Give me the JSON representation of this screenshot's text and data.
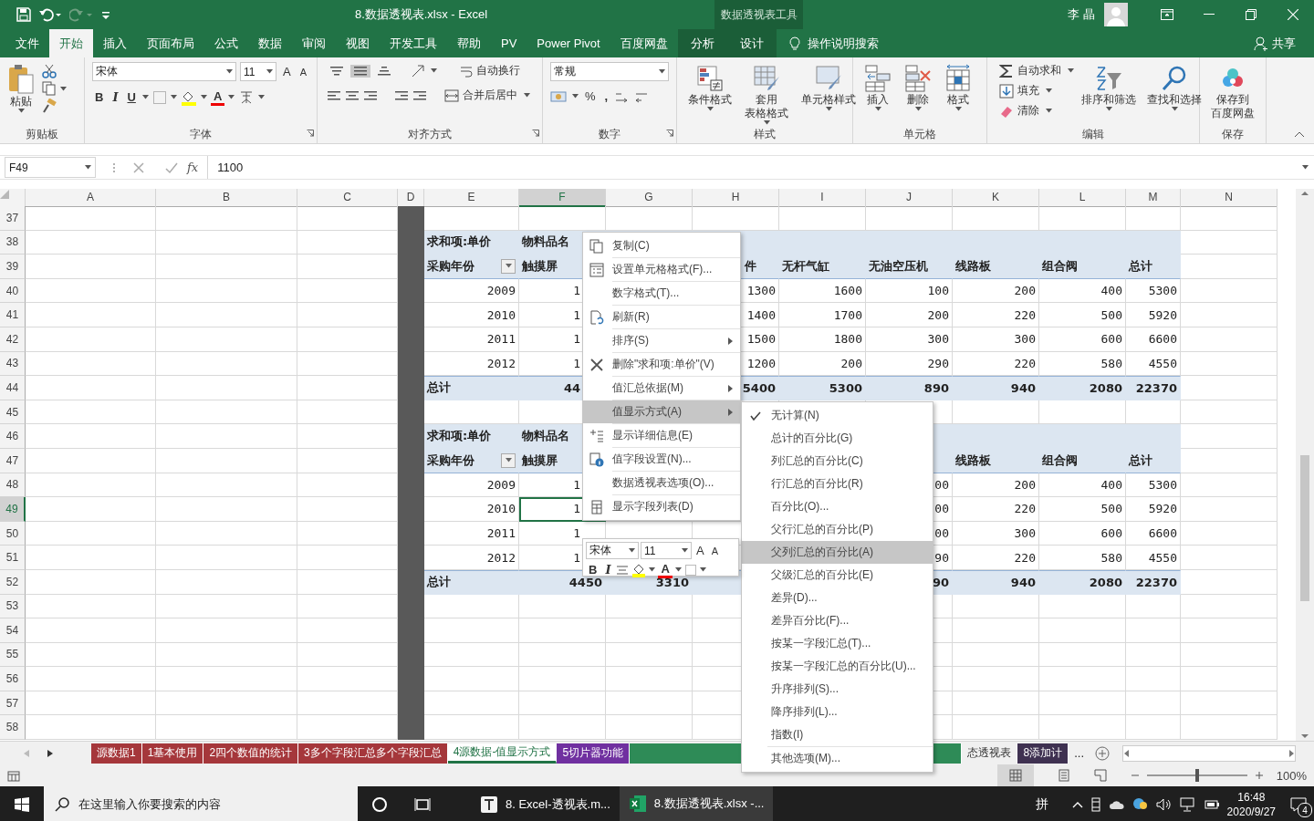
{
  "title_bar": {
    "title": "8.数据透视表.xlsx  -  Excel",
    "context_title": "数据透视表工具",
    "user": "李 晶"
  },
  "ribbon_tabs": [
    {
      "label": "文件",
      "selected": false,
      "contextual": false
    },
    {
      "label": "开始",
      "selected": true,
      "contextual": false
    },
    {
      "label": "插入",
      "selected": false,
      "contextual": false
    },
    {
      "label": "页面布局",
      "selected": false,
      "contextual": false
    },
    {
      "label": "公式",
      "selected": false,
      "contextual": false
    },
    {
      "label": "数据",
      "selected": false,
      "contextual": false
    },
    {
      "label": "审阅",
      "selected": false,
      "contextual": false
    },
    {
      "label": "视图",
      "selected": false,
      "contextual": false
    },
    {
      "label": "开发工具",
      "selected": false,
      "contextual": false
    },
    {
      "label": "帮助",
      "selected": false,
      "contextual": false
    },
    {
      "label": "PV",
      "selected": false,
      "contextual": false
    },
    {
      "label": "Power Pivot",
      "selected": false,
      "contextual": false
    },
    {
      "label": "百度网盘",
      "selected": false,
      "contextual": false
    },
    {
      "label": "分析",
      "selected": false,
      "contextual": true
    },
    {
      "label": "设计",
      "selected": false,
      "contextual": true
    }
  ],
  "tell_me": "操作说明搜索",
  "share": "共享",
  "ribbon_groups": [
    {
      "kind": "clipboard",
      "label": "剪贴板",
      "paste": "粘贴"
    },
    {
      "kind": "font",
      "label": "字体",
      "font": "宋体",
      "size": "11",
      "grow": "A",
      "shrink": "A",
      "bold": "B",
      "italic": "I",
      "underline": "U",
      "color_letter": "A"
    },
    {
      "kind": "alignment",
      "label": "对齐方式",
      "wrap": "自动换行",
      "merge": "合并后居中",
      "middle_selected": true
    },
    {
      "kind": "number",
      "label": "数字",
      "format": "常规",
      "percent": "%",
      "comma": ","
    },
    {
      "kind": "large",
      "label": "样式",
      "buttons": [
        [
          "条件格式"
        ],
        [
          "套用",
          "表格格式"
        ],
        [
          "单元格样式"
        ]
      ]
    },
    {
      "kind": "large",
      "label": "单元格",
      "buttons": [
        [
          "插入"
        ],
        [
          "删除"
        ],
        [
          "格式"
        ]
      ]
    },
    {
      "kind": "editing",
      "label": "编辑",
      "small": [
        "自动求和",
        "填充",
        "清除"
      ],
      "large": [
        "排序和筛选",
        "查找和选择"
      ]
    },
    {
      "kind": "large",
      "label": "保存",
      "buttons": [
        [
          "保存到",
          "百度网盘"
        ]
      ]
    }
  ],
  "formula_bar": {
    "name_box": "F49",
    "fx_label": "fx",
    "value": "1100"
  },
  "columns": [
    {
      "label": "A",
      "selected": false,
      "shaded": false
    },
    {
      "label": "B",
      "selected": false,
      "shaded": false
    },
    {
      "label": "C",
      "selected": false,
      "shaded": false
    },
    {
      "label": "D",
      "selected": false,
      "shaded": true
    },
    {
      "label": "E",
      "selected": false,
      "shaded": false
    },
    {
      "label": "F",
      "selected": true,
      "shaded": false
    },
    {
      "label": "G",
      "selected": false,
      "shaded": false
    },
    {
      "label": "H",
      "selected": false,
      "shaded": false
    },
    {
      "label": "I",
      "selected": false,
      "shaded": false
    },
    {
      "label": "J",
      "selected": false,
      "shaded": false
    },
    {
      "label": "K",
      "selected": false,
      "shaded": false
    },
    {
      "label": "L",
      "selected": false,
      "shaded": false
    },
    {
      "label": "M",
      "selected": false,
      "shaded": false
    },
    {
      "label": "N",
      "selected": false,
      "shaded": false
    }
  ],
  "rows": [
    {
      "number": "37",
      "selected": false,
      "kind": "plain",
      "cells": {}
    },
    {
      "number": "38",
      "selected": false,
      "kind": "title",
      "cells": {
        "E": {
          "text": "求和项:单价"
        },
        "F": {
          "text": "物料品名"
        }
      }
    },
    {
      "number": "39",
      "selected": false,
      "kind": "header",
      "cells": {
        "E": {
          "text": "采购年份",
          "filter": true
        },
        "F": {
          "text": "触摸屏"
        },
        "H": {
          "text": "件",
          "kind": "fragment"
        },
        "I": {
          "text": "无杆气缸"
        },
        "J": {
          "text": "无油空压机"
        },
        "K": {
          "text": "线路板"
        },
        "L": {
          "text": "组合阀"
        },
        "M": {
          "text": "总计"
        }
      }
    },
    {
      "number": "40",
      "selected": false,
      "kind": "data",
      "cells": {
        "E": {
          "text": "2009"
        },
        "F": {
          "text": "1",
          "kind": "fragment"
        },
        "H": {
          "text": "1300"
        },
        "I": {
          "text": "1600"
        },
        "J": {
          "text": "100"
        },
        "K": {
          "text": "200"
        },
        "L": {
          "text": "400"
        },
        "M": {
          "text": "5300"
        }
      }
    },
    {
      "number": "41",
      "selected": false,
      "kind": "data",
      "cells": {
        "E": {
          "text": "2010"
        },
        "F": {
          "text": "1",
          "kind": "fragment"
        },
        "H": {
          "text": "1400"
        },
        "I": {
          "text": "1700"
        },
        "J": {
          "text": "200"
        },
        "K": {
          "text": "220"
        },
        "L": {
          "text": "500"
        },
        "M": {
          "text": "5920"
        }
      }
    },
    {
      "number": "42",
      "selected": false,
      "kind": "data",
      "cells": {
        "E": {
          "text": "2011"
        },
        "F": {
          "text": "1",
          "kind": "fragment"
        },
        "H": {
          "text": "1500"
        },
        "I": {
          "text": "1800"
        },
        "J": {
          "text": "300"
        },
        "K": {
          "text": "300"
        },
        "L": {
          "text": "600"
        },
        "M": {
          "text": "6600"
        }
      }
    },
    {
      "number": "43",
      "selected": false,
      "kind": "data",
      "cells": {
        "E": {
          "text": "2012"
        },
        "F": {
          "text": "1",
          "kind": "fragment"
        },
        "H": {
          "text": "1200"
        },
        "I": {
          "text": "200"
        },
        "J": {
          "text": "290"
        },
        "K": {
          "text": "220"
        },
        "L": {
          "text": "580"
        },
        "M": {
          "text": "4550"
        }
      }
    },
    {
      "number": "44",
      "selected": false,
      "kind": "total",
      "cells": {
        "E": {
          "text": "总计"
        },
        "F": {
          "text": "44",
          "kind": "fragment"
        },
        "H": {
          "text": "5400"
        },
        "I": {
          "text": "5300"
        },
        "J": {
          "text": "890"
        },
        "K": {
          "text": "940"
        },
        "L": {
          "text": "2080"
        },
        "M": {
          "text": "22370"
        }
      }
    },
    {
      "number": "45",
      "selected": false,
      "kind": "plain",
      "cells": {}
    },
    {
      "number": "46",
      "selected": false,
      "kind": "title",
      "cells": {
        "E": {
          "text": "求和项:单价"
        },
        "F": {
          "text": "物料品名"
        }
      }
    },
    {
      "number": "47",
      "selected": false,
      "kind": "header",
      "cells": {
        "E": {
          "text": "采购年份",
          "filter": true
        },
        "F": {
          "text": "触摸屏"
        },
        "K": {
          "text": "线路板"
        },
        "L": {
          "text": "组合阀"
        },
        "M": {
          "text": "总计"
        }
      }
    },
    {
      "number": "48",
      "selected": false,
      "kind": "data",
      "cells": {
        "E": {
          "text": "2009"
        },
        "F": {
          "text": "1",
          "kind": "fragment"
        },
        "J": {
          "text": "00"
        },
        "K": {
          "text": "200"
        },
        "L": {
          "text": "400"
        },
        "M": {
          "text": "5300"
        }
      }
    },
    {
      "number": "49",
      "selected": true,
      "kind": "data",
      "cells": {
        "E": {
          "text": "2010"
        },
        "F": {
          "text": "1",
          "kind": "fragment"
        },
        "J": {
          "text": "00"
        },
        "K": {
          "text": "220"
        },
        "L": {
          "text": "500"
        },
        "M": {
          "text": "5920"
        }
      }
    },
    {
      "number": "50",
      "selected": false,
      "kind": "data",
      "cells": {
        "E": {
          "text": "2011"
        },
        "F": {
          "text": "1",
          "kind": "fragment"
        },
        "J": {
          "text": "00"
        },
        "K": {
          "text": "300"
        },
        "L": {
          "text": "600"
        },
        "M": {
          "text": "6600"
        }
      }
    },
    {
      "number": "51",
      "selected": false,
      "kind": "data",
      "cells": {
        "E": {
          "text": "2012"
        },
        "F": {
          "text": "1",
          "kind": "fragment"
        },
        "J": {
          "text": "90"
        },
        "K": {
          "text": "220"
        },
        "L": {
          "text": "580"
        },
        "M": {
          "text": "4550"
        }
      }
    },
    {
      "number": "52",
      "selected": false,
      "kind": "total",
      "cells": {
        "E": {
          "text": "总计"
        },
        "F": {
          "text": "4450"
        },
        "G": {
          "text": "3310"
        },
        "J": {
          "text": "90"
        },
        "K": {
          "text": "940"
        },
        "L": {
          "text": "2080"
        },
        "M": {
          "text": "22370"
        }
      }
    },
    {
      "number": "53",
      "selected": false,
      "kind": "plain",
      "cells": {}
    },
    {
      "number": "54",
      "selected": false,
      "kind": "plain",
      "cells": {}
    },
    {
      "number": "55",
      "selected": false,
      "kind": "plain",
      "cells": {}
    },
    {
      "number": "56",
      "selected": false,
      "kind": "plain",
      "cells": {}
    },
    {
      "number": "57",
      "selected": false,
      "kind": "plain",
      "cells": {}
    },
    {
      "number": "58",
      "selected": false,
      "kind": "plain",
      "cells": {}
    }
  ],
  "context_menu": [
    {
      "label": "复制(C)",
      "selected": false,
      "submenu": false
    },
    {
      "label": "设置单元格格式(F)...",
      "selected": false,
      "submenu": false
    },
    {
      "label": "数字格式(T)...",
      "selected": false,
      "submenu": false
    },
    {
      "label": "刷新(R)",
      "selected": false,
      "submenu": false
    },
    {
      "label": "排序(S)",
      "selected": false,
      "submenu": true
    },
    {
      "label": "删除\"求和项:单价\"(V)",
      "selected": false,
      "submenu": false
    },
    {
      "label": "值汇总依据(M)",
      "selected": false,
      "submenu": true
    },
    {
      "label": "值显示方式(A)",
      "selected": true,
      "submenu": true
    },
    {
      "label": "显示详细信息(E)",
      "selected": false,
      "submenu": false
    },
    {
      "label": "值字段设置(N)...",
      "selected": false,
      "submenu": false
    },
    {
      "label": "数据透视表选项(O)...",
      "selected": false,
      "submenu": false
    },
    {
      "label": "显示字段列表(D)",
      "selected": false,
      "submenu": false
    }
  ],
  "value_display_menu": [
    {
      "label": "无计算(N)",
      "checked": true,
      "selected": false
    },
    {
      "label": "总计的百分比(G)",
      "checked": false,
      "selected": false
    },
    {
      "label": "列汇总的百分比(C)",
      "checked": false,
      "selected": false
    },
    {
      "label": "行汇总的百分比(R)",
      "checked": false,
      "selected": false
    },
    {
      "label": "百分比(O)...",
      "checked": false,
      "selected": false
    },
    {
      "label": "父行汇总的百分比(P)",
      "checked": false,
      "selected": false
    },
    {
      "label": "父列汇总的百分比(A)",
      "checked": false,
      "selected": true
    },
    {
      "label": "父级汇总的百分比(E)",
      "checked": false,
      "selected": false
    },
    {
      "label": "差异(D)...",
      "checked": false,
      "selected": false
    },
    {
      "label": "差异百分比(F)...",
      "checked": false,
      "selected": false
    },
    {
      "label": "按某一字段汇总(T)...",
      "checked": false,
      "selected": false
    },
    {
      "label": "按某一字段汇总的百分比(U)...",
      "checked": false,
      "selected": false
    },
    {
      "label": "升序排列(S)...",
      "checked": false,
      "selected": false
    },
    {
      "label": "降序排列(L)...",
      "checked": false,
      "selected": false
    },
    {
      "label": "指数(I)",
      "checked": false,
      "selected": false
    },
    {
      "label": "其他选项(M)...",
      "checked": false,
      "selected": false
    }
  ],
  "mini_toolbar": {
    "font": "宋体",
    "size": "11",
    "grow": "A",
    "shrink": "A",
    "bold": "B",
    "italic": "I",
    "color_letter": "A"
  },
  "sheet_tabs": [
    {
      "label": "源数据1",
      "color": "#a5373b",
      "selected": false
    },
    {
      "label": "1基本使用",
      "color": "#a5373b",
      "selected": false
    },
    {
      "label": "2四个数值的统计",
      "color": "#a5373b",
      "selected": false
    },
    {
      "label": "3多个字段汇总多个字段汇总",
      "color": "#a5373b",
      "selected": false
    },
    {
      "label": "4源数据-值显示方式",
      "selected": true
    },
    {
      "label": "5切片器功能",
      "color": "#7030a0",
      "selected": false
    },
    {
      "color": "#2e8b57",
      "selected": false
    },
    {
      "label": "态透视表",
      "selected": false
    },
    {
      "label": "8添加计",
      "color": "#3f3151",
      "selected": false
    }
  ],
  "sheet_more": "...",
  "status_bar": {
    "zoom": "100%",
    "zoom_slider": {
      "level": 0.5
    }
  },
  "taskbar": {
    "search": "在这里输入你要搜索的内容",
    "apps": [
      {
        "label": "8. Excel-透视表.m...",
        "kind": "editor",
        "selected": false
      },
      {
        "label": "8.数据透视表.xlsx -...",
        "kind": "spreadsheet",
        "selected": true
      }
    ],
    "ime": "拼",
    "time": "16:48",
    "date": "2020/9/27",
    "notifications": "4"
  }
}
